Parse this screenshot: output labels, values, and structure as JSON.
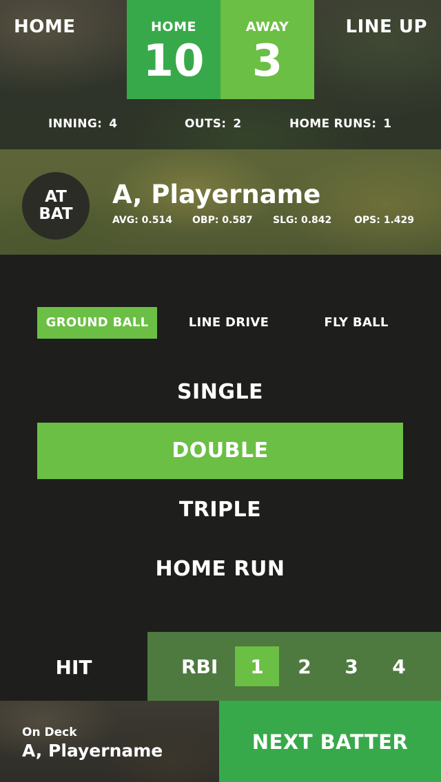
{
  "header": {
    "home_nav": "HOME",
    "lineup_nav": "LINE UP"
  },
  "scoreboard": {
    "home_label": "HOME",
    "home_score": "10",
    "away_label": "AWAY",
    "away_score": "3"
  },
  "game_status": {
    "inning_label": "INNING:",
    "inning_value": "4",
    "outs_label": "OUTS:",
    "outs_value": "2",
    "home_runs_label": "HOME RUNS:",
    "home_runs_value": "1"
  },
  "at_bat": {
    "badge_line1": "AT",
    "badge_line2": "BAT",
    "player_name": "A, Playername",
    "avg": "AVG: 0.514",
    "obp": "OBP: 0.587",
    "slg": "SLG: 0.842",
    "ops": "OPS: 1.429"
  },
  "hit_types": {
    "selected": "GROUND BALL",
    "options": [
      "GROUND BALL",
      "LINE DRIVE",
      "FLY BALL"
    ]
  },
  "results": {
    "selected": "DOUBLE",
    "options": [
      "SINGLE",
      "DOUBLE",
      "TRIPLE",
      "HOME RUN"
    ]
  },
  "scoring": {
    "hit_label": "HIT",
    "rbi_label": "RBI",
    "rbi_selected": "1",
    "rbi_options": [
      "1",
      "2",
      "3",
      "4"
    ]
  },
  "footer": {
    "on_deck_label": "On Deck",
    "on_deck_name": "A, Playername",
    "next_batter_label": "NEXT BATTER"
  },
  "colors": {
    "accent_green": "#6bbf44",
    "home_green": "#38a94a",
    "rbi_panel": "#4e7a40",
    "background": "#1e1e1c"
  }
}
